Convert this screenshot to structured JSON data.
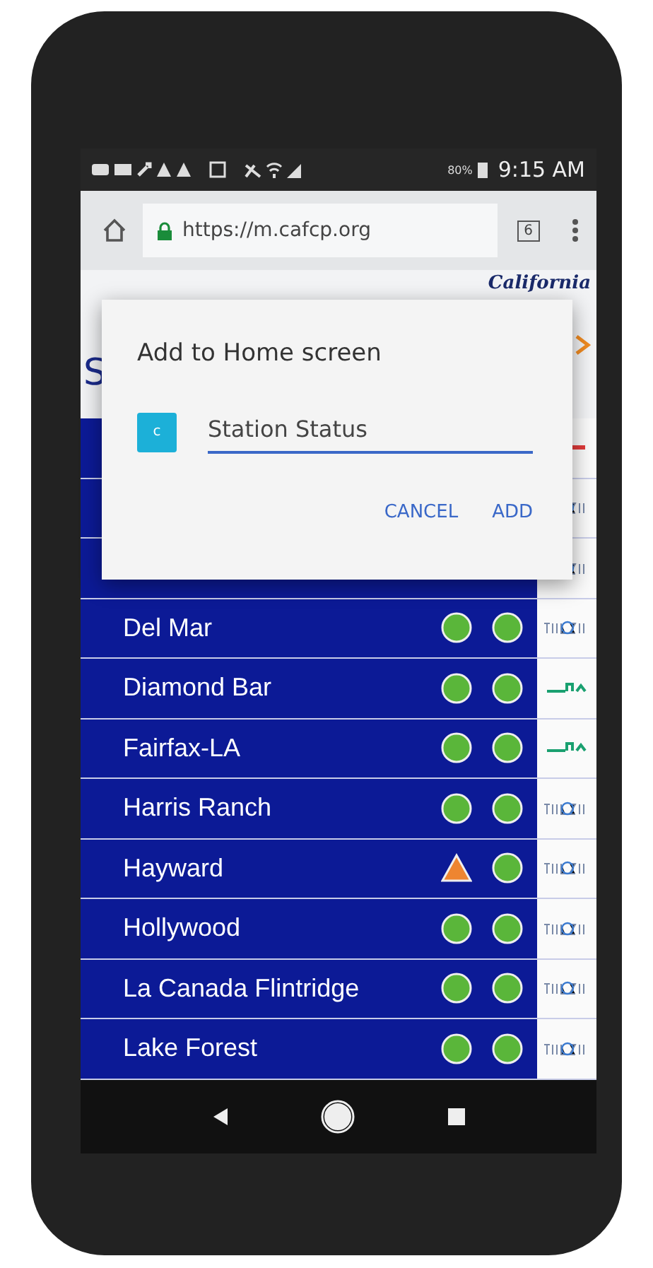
{
  "status_bar": {
    "battery": "80%",
    "time": "9:15 AM"
  },
  "browser": {
    "url": "https://m.cafcp.org",
    "tab_count": "6"
  },
  "page": {
    "brand": "California",
    "title": "S"
  },
  "stations": [
    {
      "provider": {
        "kind": "red"
      }
    },
    {
      "provider": {
        "kind": "truezero"
      }
    },
    {
      "provider": {
        "kind": "truezero"
      }
    },
    {
      "name": "Del Mar",
      "statuses": [
        {
          "kind": "ok"
        },
        {
          "kind": "ok"
        }
      ],
      "provider": {
        "kind": "truezero"
      }
    },
    {
      "name": "Diamond Bar",
      "statuses": [
        {
          "kind": "ok"
        },
        {
          "kind": "ok"
        }
      ],
      "provider": {
        "kind": "green"
      }
    },
    {
      "name": "Fairfax-LA",
      "statuses": [
        {
          "kind": "ok"
        },
        {
          "kind": "ok"
        }
      ],
      "provider": {
        "kind": "green"
      }
    },
    {
      "name": "Harris Ranch",
      "statuses": [
        {
          "kind": "ok"
        },
        {
          "kind": "ok"
        }
      ],
      "provider": {
        "kind": "truezero"
      }
    },
    {
      "name": "Hayward",
      "statuses": [
        {
          "kind": "warning"
        },
        {
          "kind": "ok"
        }
      ],
      "provider": {
        "kind": "truezero"
      }
    },
    {
      "name": "Hollywood",
      "statuses": [
        {
          "kind": "ok"
        },
        {
          "kind": "ok"
        }
      ],
      "provider": {
        "kind": "truezero"
      }
    },
    {
      "name": "La Canada Flintridge",
      "statuses": [
        {
          "kind": "ok"
        },
        {
          "kind": "ok"
        }
      ],
      "provider": {
        "kind": "truezero"
      }
    },
    {
      "name": "Lake Forest",
      "statuses": [
        {
          "kind": "ok"
        },
        {
          "kind": "ok"
        }
      ],
      "provider": {
        "kind": "truezero"
      }
    }
  ],
  "dialog": {
    "title": "Add to Home screen",
    "app_icon_letter": "c",
    "name_value": "Station Status",
    "buttons": [
      "CANCEL",
      "ADD"
    ]
  }
}
